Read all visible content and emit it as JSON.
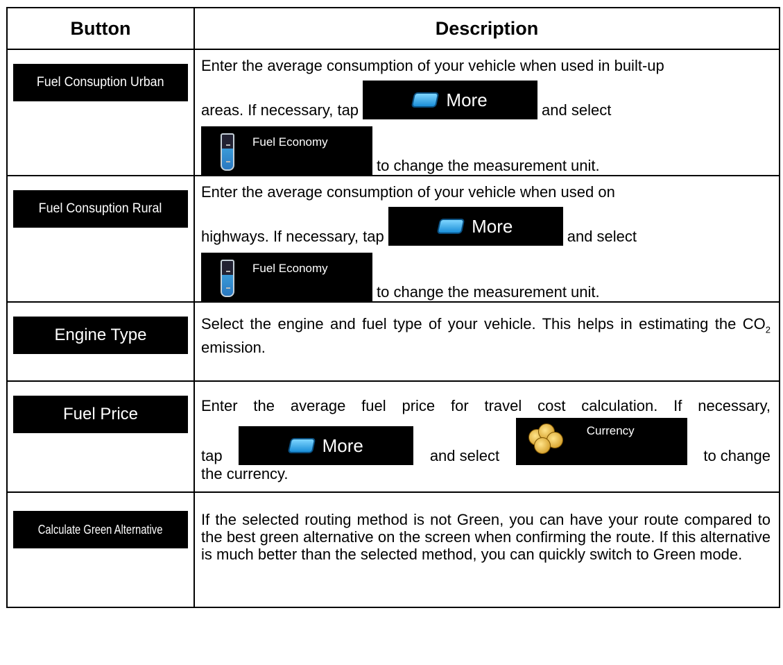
{
  "headers": {
    "button": "Button",
    "description": "Description"
  },
  "more_label": "More",
  "fuel_economy_label": "Fuel Economy",
  "currency_label": "Currency",
  "rows": [
    {
      "button": "Fuel Consuption Urban",
      "t1": "Enter the average consumption of your vehicle when used in built-up",
      "t2": "areas. If necessary, tap",
      "t3": "and select",
      "t4": "to change the measurement unit."
    },
    {
      "button": "Fuel Consuption Rural",
      "t1": "Enter the average consumption of your vehicle when used on",
      "t2": "highways. If necessary, tap",
      "t3": "and select",
      "t4": "to change the measurement unit."
    },
    {
      "button": "Engine Type",
      "t1": "Select the engine and fuel type of your vehicle. This helps in estimating the CO",
      "sub": "2",
      "t2": " emission."
    },
    {
      "button": "Fuel Price",
      "t1": "Enter the average fuel price for travel cost calculation. If necessary,",
      "t2": "tap",
      "t3": "and select",
      "t4": "to change",
      "t5": "the currency."
    },
    {
      "button": "Calculate Green Alternative",
      "t1": "If the selected routing method is not Green, you can have your route compared to the best green alternative on the screen when confirming the route. If this alternative is much better than the selected method, you can quickly switch to Green mode."
    }
  ]
}
